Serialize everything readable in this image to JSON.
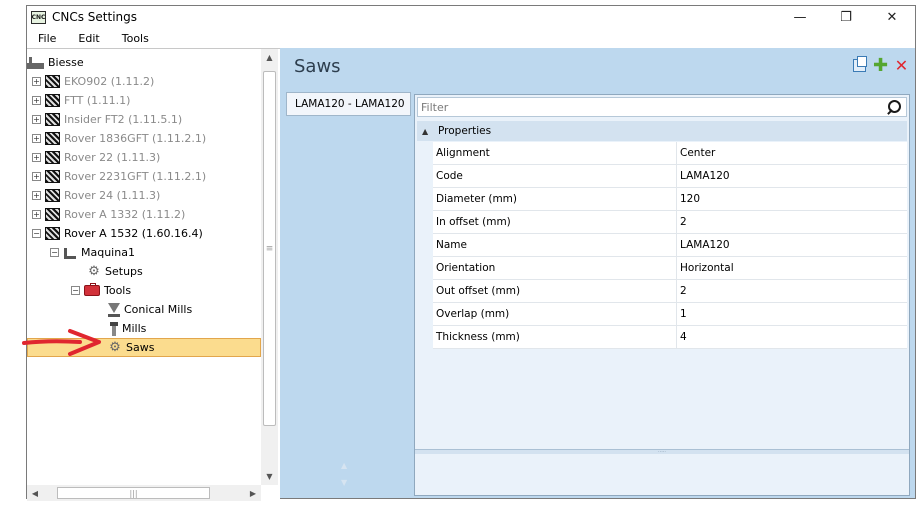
{
  "window": {
    "app_icon_text": "CNC",
    "title": "CNCs Settings",
    "controls": {
      "minimize": "—",
      "restore": "❐",
      "close": "✕"
    }
  },
  "menu": [
    "File",
    "Edit",
    "Tools"
  ],
  "tree": {
    "root": "Biesse",
    "machines": [
      {
        "label": "EKO902 (1.11.2)",
        "expander": "+"
      },
      {
        "label": "FTT (1.11.1)",
        "expander": "+"
      },
      {
        "label": "Insider FT2 (1.11.5.1)",
        "expander": "+"
      },
      {
        "label": "Rover 1836GFT (1.11.2.1)",
        "expander": "+"
      },
      {
        "label": "Rover 22 (1.11.3)",
        "expander": "+"
      },
      {
        "label": "Rover 2231GFT (1.11.2.1)",
        "expander": "+"
      },
      {
        "label": "Rover 24 (1.11.3)",
        "expander": "+"
      },
      {
        "label": "Rover A 1332 (1.11.2)",
        "expander": "+"
      },
      {
        "label": "Rover A 1532 (1.60.16.4)",
        "expander": "−"
      }
    ],
    "maquina": {
      "label": "Maquina1",
      "expander": "−"
    },
    "setups": "Setups",
    "tools": {
      "label": "Tools",
      "expander": "−"
    },
    "conical_mills": "Conical Mills",
    "mills": "Mills",
    "saws": "Saws"
  },
  "scrollbars": {
    "up": "▲",
    "down": "▼",
    "left": "◀",
    "right": "▶",
    "grip_vertical": "≡",
    "grip_horizontal": "|||"
  },
  "panel": {
    "title": "Saws",
    "list_items": [
      "LAMA120 - LAMA120"
    ],
    "filter_placeholder": "Filter",
    "section_label": "Properties",
    "collapse_glyph": "▲",
    "properties": [
      {
        "name": "Alignment",
        "value": "Center"
      },
      {
        "name": "Code",
        "value": "LAMA120"
      },
      {
        "name": "Diameter (mm)",
        "value": "120"
      },
      {
        "name": "In offset (mm)",
        "value": "2"
      },
      {
        "name": "Name",
        "value": "LAMA120"
      },
      {
        "name": "Orientation",
        "value": "Horizontal"
      },
      {
        "name": "Out offset (mm)",
        "value": "2"
      },
      {
        "name": "Overlap (mm)",
        "value": "1"
      },
      {
        "name": "Thickness (mm)",
        "value": "4"
      }
    ],
    "splitter_grip": "·····"
  },
  "colors": {
    "panel_bg": "#bdd8ee",
    "selection": "#fbdc8e",
    "accent_red": "#e0262f",
    "accent_green": "#55a630"
  }
}
